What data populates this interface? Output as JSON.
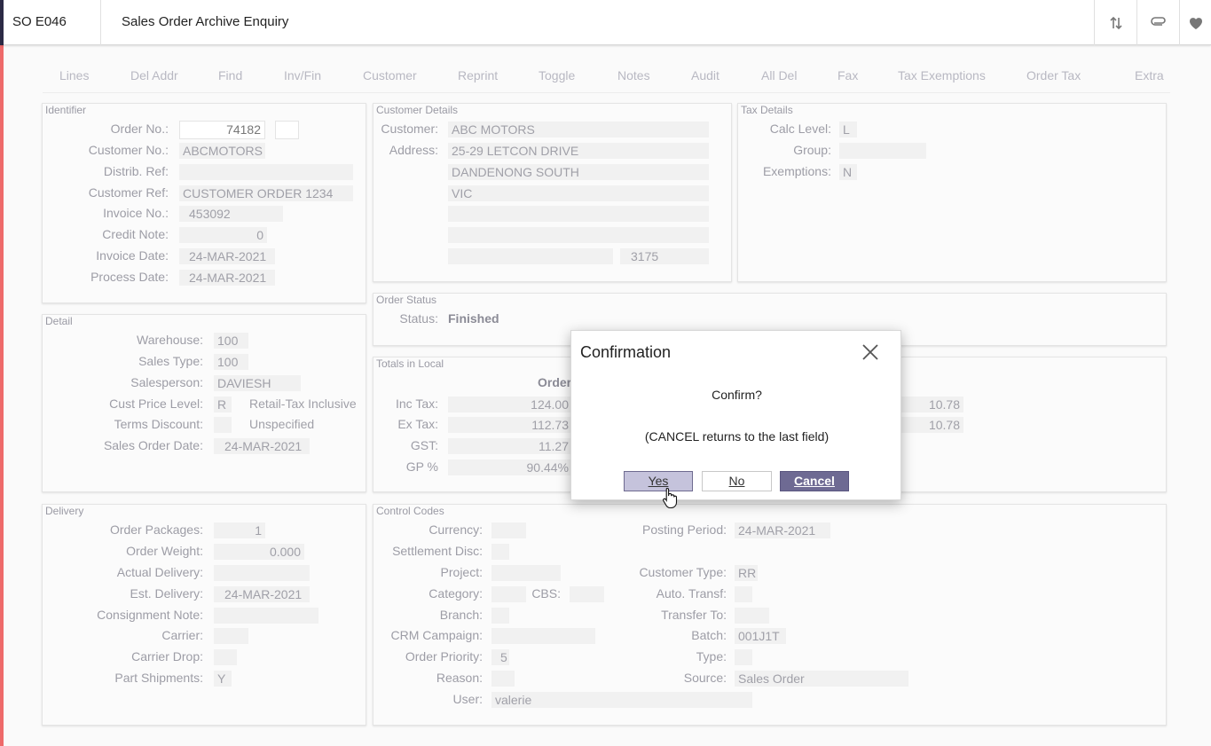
{
  "header": {
    "code": "SO E046",
    "title": "Sales Order Archive Enquiry",
    "icons": [
      "sort-arrows-icon",
      "paperclip-icon",
      "heart-icon"
    ]
  },
  "toolbar": [
    "Lines",
    "Del Addr",
    "Find",
    "Inv/Fin",
    "Customer",
    "Reprint",
    "Toggle",
    "Notes",
    "Audit",
    "All Del",
    "Fax",
    "Tax Exemptions",
    "Order Tax",
    "Extra"
  ],
  "identifier": {
    "title": "Identifier",
    "order_no_label": "Order No.:",
    "order_no": "74182",
    "customer_no_label": "Customer No.:",
    "customer_no": "ABCMOTORS",
    "distrib_ref_label": "Distrib. Ref:",
    "distrib_ref": "",
    "customer_ref_label": "Customer Ref:",
    "customer_ref": "CUSTOMER ORDER 1234",
    "invoice_no_label": "Invoice No.:",
    "invoice_no": "453092",
    "credit_note_label": "Credit Note:",
    "credit_note": "0",
    "invoice_date_label": "Invoice Date:",
    "invoice_date": "24-MAR-2021",
    "process_date_label": "Process Date:",
    "process_date": "24-MAR-2021"
  },
  "customer_details": {
    "title": "Customer Details",
    "customer_label": "Customer:",
    "customer": "ABC MOTORS",
    "address_label": "Address:",
    "address1": "25-29 LETCON DRIVE",
    "address2": "DANDENONG SOUTH",
    "address3": "VIC",
    "postcode": "3175"
  },
  "tax_details": {
    "title": "Tax Details",
    "calc_level_label": "Calc Level:",
    "calc_level": "L",
    "group_label": "Group:",
    "group": "",
    "exemptions_label": "Exemptions:",
    "exemptions": "N"
  },
  "detail": {
    "title": "Detail",
    "warehouse_label": "Warehouse:",
    "warehouse": "100",
    "sales_type_label": "Sales Type:",
    "sales_type": "100",
    "salesperson_label": "Salesperson:",
    "salesperson": "DAVIESH",
    "cust_price_level_label": "Cust Price Level:",
    "cust_price_level": "R",
    "cust_price_level_desc": "Retail-Tax Inclusive",
    "terms_discount_label": "Terms Discount:",
    "terms_discount_desc": "Unspecified",
    "sales_order_date_label": "Sales Order Date:",
    "sales_order_date": "24-MAR-2021"
  },
  "order_status": {
    "title": "Order Status",
    "status_label": "Status:",
    "status": "Finished"
  },
  "totals": {
    "title": "Totals in Local",
    "column_header": "Order",
    "inc_tax_label": "Inc Tax:",
    "inc_tax": "124.00",
    "inc_tax_2": "10.78",
    "ex_tax_label": "Ex Tax:",
    "ex_tax": "112.73",
    "ex_tax_2": "10.78",
    "gst_label": "GST:",
    "gst": "11.27",
    "gp_label": "GP %",
    "gp": "90.44%"
  },
  "delivery": {
    "title": "Delivery",
    "order_packages_label": "Order Packages:",
    "order_packages": "1",
    "order_weight_label": "Order Weight:",
    "order_weight": "0.000",
    "actual_delivery_label": "Actual Delivery:",
    "actual_delivery": "",
    "est_delivery_label": "Est. Delivery:",
    "est_delivery": "24-MAR-2021",
    "consignment_note_label": "Consignment Note:",
    "consignment_note": "",
    "carrier_label": "Carrier:",
    "carrier": "",
    "carrier_drop_label": "Carrier Drop:",
    "carrier_drop": "",
    "part_shipments_label": "Part Shipments:",
    "part_shipments": "Y"
  },
  "control_codes": {
    "title": "Control Codes",
    "currency_label": "Currency:",
    "currency": "",
    "settlement_disc_label": "Settlement Disc:",
    "settlement_disc": "",
    "project_label": "Project:",
    "project": "",
    "category_label": "Category:",
    "category": "",
    "cbs_label": "CBS:",
    "cbs": "",
    "branch_label": "Branch:",
    "branch": "",
    "crm_campaign_label": "CRM Campaign:",
    "crm_campaign": "",
    "order_priority_label": "Order Priority:",
    "order_priority": "5",
    "reason_label": "Reason:",
    "reason": "",
    "user_label": "User:",
    "user": "valerie",
    "posting_period_label": "Posting Period:",
    "posting_period": "24-MAR-2021",
    "customer_type_label": "Customer Type:",
    "customer_type": "RR",
    "auto_transf_label": "Auto. Transf:",
    "auto_transf": "",
    "transfer_to_label": "Transfer To:",
    "transfer_to": "",
    "batch_label": "Batch:",
    "batch": "001J1T",
    "type_label": "Type:",
    "type": "",
    "source_label": "Source:",
    "source": "Sales Order"
  },
  "dialog": {
    "title": "Confirmation",
    "message": "Confirm?",
    "hint": "(CANCEL returns to the last field)",
    "yes": "Yes",
    "no": "No",
    "cancel": "Cancel"
  }
}
